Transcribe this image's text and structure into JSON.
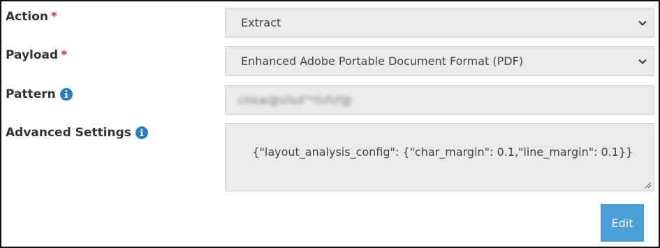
{
  "form": {
    "action": {
      "label": "Action",
      "required_mark": "*",
      "selected": "Extract"
    },
    "payload": {
      "label": "Payload",
      "required_mark": "*",
      "selected": "Enhanced Adobe Portable Document Format (PDF)"
    },
    "pattern": {
      "label": "Pattern",
      "value_redacted": "chkw@sfsd\"*fsfsf@"
    },
    "advanced": {
      "label": "Advanced Settings",
      "value": "{\"layout_analysis_config\": {\"char_margin\": 0.1,\"line_margin\": 0.1}}"
    },
    "edit_button_label": "Edit"
  },
  "colors": {
    "required": "#d0312d",
    "info_icon": "#2a7bc0",
    "button": "#4a9fd8",
    "field_bg": "#ebebeb"
  },
  "icons": {
    "info": "info-circle-icon",
    "chevron": "chevron-down-icon",
    "resize": "resize-grip-icon"
  }
}
